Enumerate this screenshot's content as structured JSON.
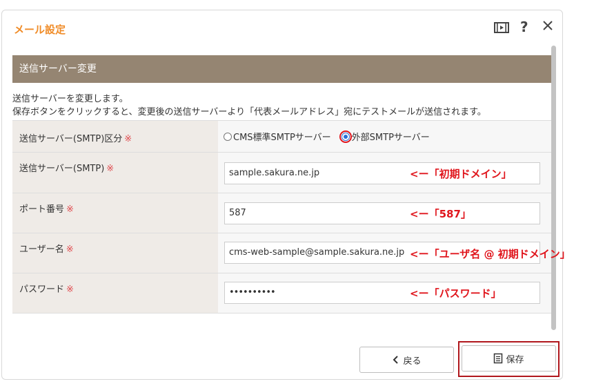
{
  "dialog": {
    "title": "メール設定",
    "icons": [
      "video-icon",
      "help-icon",
      "close-icon"
    ],
    "help_glyph": "?"
  },
  "section": {
    "title": "送信サーバー変更",
    "description_line1": "送信サーバーを変更します。",
    "description_line2": "保存ボタンをクリックすると、変更後の送信サーバーより「代表メールアドレス」宛にテストメールが送信されます。"
  },
  "form": {
    "required_mark": "※",
    "server_type": {
      "label": "送信サーバー(SMTP)区分",
      "options": [
        "CMS標準SMTPサーバー",
        "外部SMTPサーバー"
      ],
      "selected": "外部SMTPサーバー"
    },
    "smtp_server": {
      "label": "送信サーバー(SMTP)",
      "value": "sample.sakura.ne.jp",
      "annotation": "<ー「初期ドメイン」"
    },
    "port": {
      "label": "ポート番号",
      "value": "587",
      "annotation": "<ー「587」"
    },
    "username": {
      "label": "ユーザー名",
      "value": "cms-web-sample@sample.sakura.ne.jp",
      "annotation": "<ー「ユーザ名 @ 初期ドメイン」"
    },
    "password": {
      "label": "パスワード",
      "value": "••••••••••",
      "annotation": "<ー「パスワード」"
    }
  },
  "buttons": {
    "back_label": "戻る",
    "save_label": "保存"
  },
  "colors": {
    "title_orange": "#f08c28",
    "section_bar": "#958572",
    "annotation_red": "#e0151c",
    "radio_blue": "#2a6fd6"
  }
}
